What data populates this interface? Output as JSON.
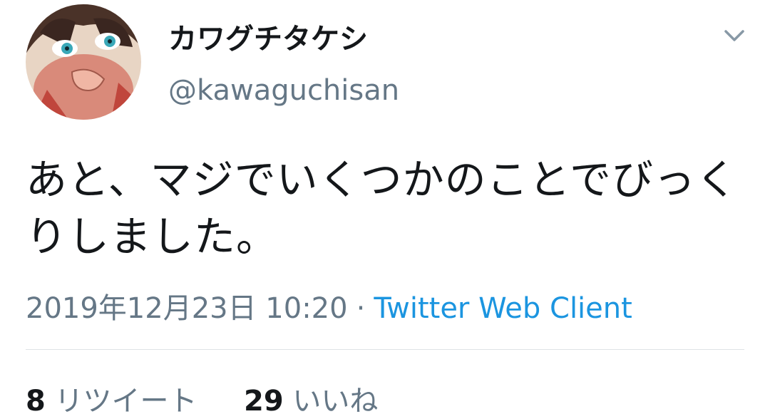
{
  "user": {
    "display_name": "カワグチタケシ",
    "handle": "@kawaguchisan",
    "avatar_icon": "avatar-image"
  },
  "tweet": {
    "text": "あと、マジでいくつかのことでびっくりしました。",
    "timestamp": "2019年12月23日 10:20",
    "separator": "·",
    "source": "Twitter Web Client"
  },
  "stats": {
    "retweets_count": "8",
    "retweets_label": "リツイート",
    "likes_count": "29",
    "likes_label": "いいね"
  },
  "icons": {
    "menu": "chevron-down-icon"
  },
  "colors": {
    "text": "#14171a",
    "secondary": "#657786",
    "link": "#1b95e0",
    "divider": "#dfe3e6"
  }
}
